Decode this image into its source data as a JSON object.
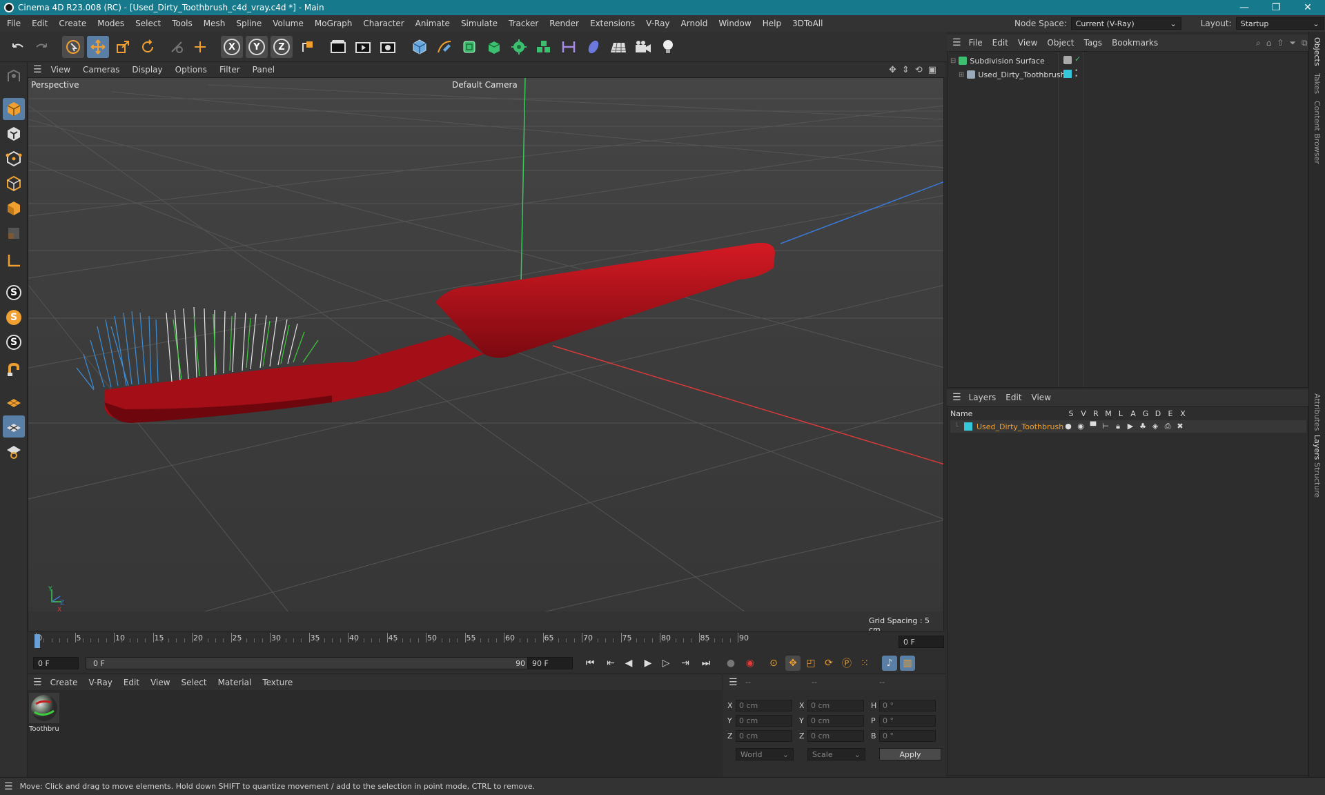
{
  "window": {
    "title": "Cinema 4D R23.008 (RC) - [Used_Dirty_Toothbrush_c4d_vray.c4d *] - Main",
    "minimize": "—",
    "maximize": "❐",
    "close": "✕"
  },
  "menubar": {
    "items": [
      "File",
      "Edit",
      "Create",
      "Modes",
      "Select",
      "Tools",
      "Mesh",
      "Spline",
      "Volume",
      "MoGraph",
      "Character",
      "Animate",
      "Simulate",
      "Tracker",
      "Render",
      "Extensions",
      "V-Ray",
      "Arnold",
      "Window",
      "Help",
      "3DToAll"
    ],
    "node_space_label": "Node Space:",
    "node_space_value": "Current (V-Ray)",
    "layout_label": "Layout:",
    "layout_value": "Startup"
  },
  "viewport": {
    "menu": [
      "View",
      "Cameras",
      "Display",
      "Options",
      "Filter",
      "Panel"
    ],
    "label": "Perspective",
    "camera": "Default Camera",
    "grid_spacing": "Grid Spacing : 5 cm",
    "axis_y": "Y",
    "axis_z": "Z",
    "axis_x": "X"
  },
  "timeline": {
    "ticks": [
      "0",
      "5",
      "10",
      "15",
      "20",
      "25",
      "30",
      "35",
      "40",
      "45",
      "50",
      "55",
      "60",
      "65",
      "70",
      "75",
      "80",
      "85",
      "90"
    ],
    "current_frame": "0 F",
    "start_field": "0 F",
    "range_start": "0 F",
    "range_end": "90 F",
    "end_field": "90 F"
  },
  "material_manager": {
    "menu": [
      "Create",
      "V-Ray",
      "Edit",
      "View",
      "Select",
      "Material",
      "Texture"
    ],
    "materials": [
      {
        "name": "Toothbru"
      }
    ]
  },
  "coordinates": {
    "headers": [
      "--",
      "--",
      "--"
    ],
    "rows": [
      {
        "a": "X",
        "av": "0 cm",
        "b": "X",
        "bv": "0 cm",
        "c": "H",
        "cv": "0 °"
      },
      {
        "a": "Y",
        "av": "0 cm",
        "b": "Y",
        "bv": "0 cm",
        "c": "P",
        "cv": "0 °"
      },
      {
        "a": "Z",
        "av": "0 cm",
        "b": "Z",
        "bv": "0 cm",
        "c": "B",
        "cv": "0 °"
      }
    ],
    "mode": "World",
    "scale": "Scale",
    "apply": "Apply"
  },
  "object_manager": {
    "menu": [
      "File",
      "Edit",
      "View",
      "Object",
      "Tags",
      "Bookmarks"
    ],
    "objects": [
      {
        "name": "Subdivision Surface",
        "level": 0
      },
      {
        "name": "Used_Dirty_Toothbrush",
        "level": 1
      }
    ]
  },
  "layer_manager": {
    "menu": [
      "Layers",
      "Edit",
      "View"
    ],
    "col_name": "Name",
    "cols": [
      "S",
      "V",
      "R",
      "M",
      "L",
      "A",
      "G",
      "D",
      "E",
      "X"
    ],
    "layers": [
      {
        "name": "Used_Dirty_Toothbrush",
        "color": "#35c7d9"
      }
    ]
  },
  "side_tabs": [
    "Objects",
    "Takes",
    "Content Browser",
    "Attributes",
    "Layers",
    "Structure"
  ],
  "status": "Move: Click and drag to move elements. Hold down SHIFT to quantize movement / add to the selection in point mode, CTRL to remove.",
  "colors": {
    "accent": "#5a7fa6",
    "titlebar": "#177a8c",
    "layer_color": "#35c7d9",
    "toothbrush": "#b0101a",
    "playhead": "#6aa0d8"
  }
}
